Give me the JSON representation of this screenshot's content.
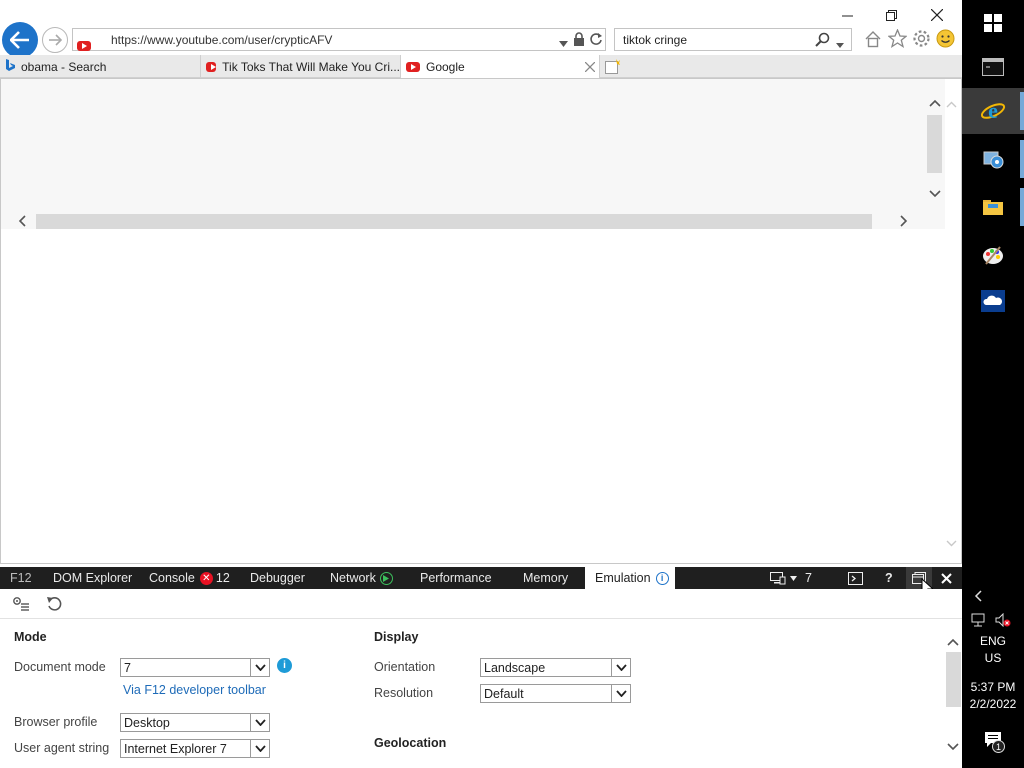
{
  "browser": {
    "address": {
      "url": "https://www.youtube.com/user/crypticAFV"
    },
    "search": {
      "value": "tiktok cringe"
    },
    "tabs": [
      {
        "label": "obama - Search",
        "icon": "bing-icon",
        "active": false
      },
      {
        "label": "Tik Toks That Will Make You Cri...",
        "icon": "youtube-icon",
        "active": false
      },
      {
        "label": "Google",
        "icon": "youtube-icon",
        "active": true
      }
    ]
  },
  "devtools": {
    "tabs": [
      {
        "label": "F12",
        "name": "devtools-f12-label"
      },
      {
        "label": "DOM Explorer",
        "name": "tab-dom-explorer"
      },
      {
        "label": "Console",
        "name": "tab-console"
      },
      {
        "label": "Debugger",
        "name": "tab-debugger"
      },
      {
        "label": "Network",
        "name": "tab-network"
      },
      {
        "label": "Performance",
        "name": "tab-performance"
      },
      {
        "label": "Memory",
        "name": "tab-memory"
      },
      {
        "label": "Emulation",
        "name": "tab-emulation"
      }
    ],
    "console_error_count": "12",
    "target_document_mode": "7",
    "emulation": {
      "mode_heading": "Mode",
      "document_mode_label": "Document mode",
      "document_mode_value": "7",
      "via_link": "Via F12 developer toolbar",
      "browser_profile_label": "Browser profile",
      "browser_profile_value": "Desktop",
      "user_agent_label": "User agent string",
      "user_agent_value": "Internet Explorer 7",
      "display_heading": "Display",
      "orientation_label": "Orientation",
      "orientation_value": "Landscape",
      "resolution_label": "Resolution",
      "resolution_value": "Default",
      "geolocation_heading": "Geolocation"
    }
  },
  "taskbar": {
    "language": "ENG",
    "region": "US",
    "time": "5:37 PM",
    "date": "2/2/2022",
    "notification_count": "1"
  },
  "colors": {
    "accent": "#1e73c9",
    "devtools_bar": "#1f1f1f",
    "error": "#e81123",
    "youtube": "#e02020"
  }
}
